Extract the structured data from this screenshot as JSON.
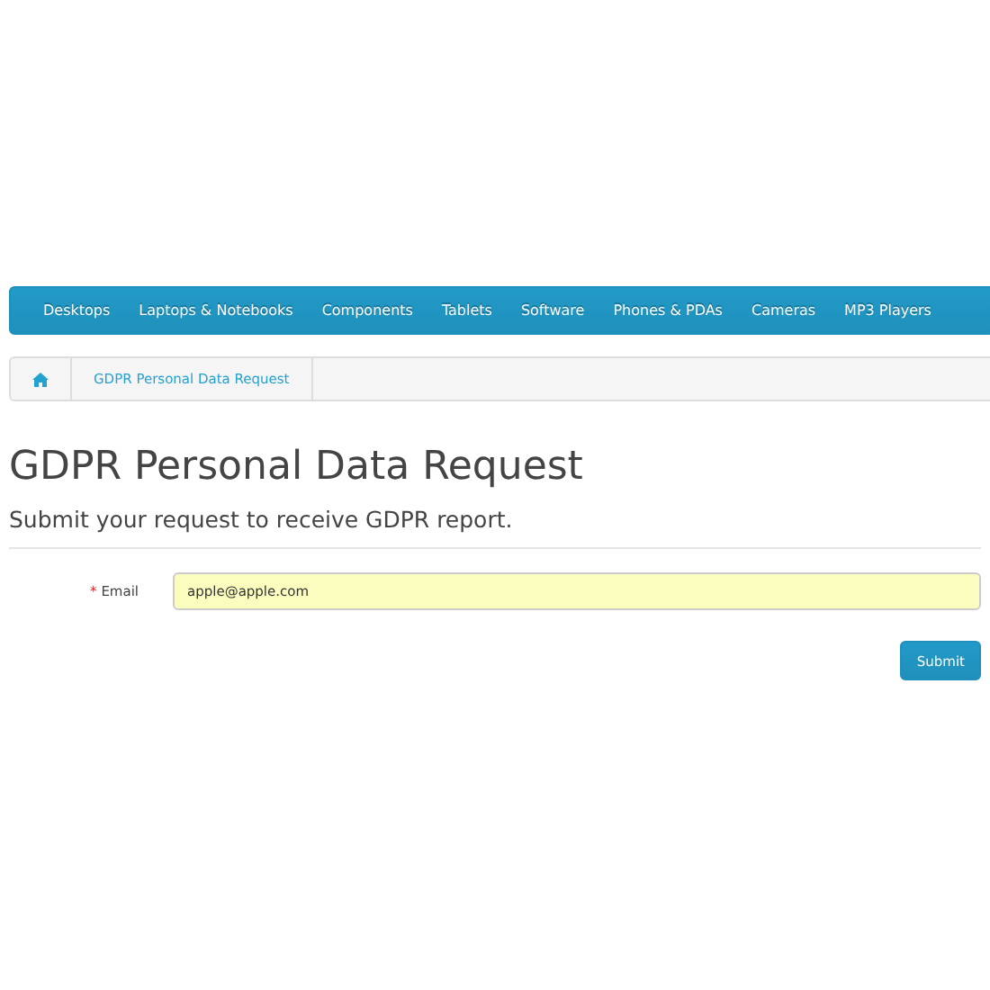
{
  "menu": [
    {
      "label": "Desktops"
    },
    {
      "label": "Laptops & Notebooks"
    },
    {
      "label": "Components"
    },
    {
      "label": "Tablets"
    },
    {
      "label": "Software"
    },
    {
      "label": "Phones & PDAs"
    },
    {
      "label": "Cameras"
    },
    {
      "label": "MP3 Players"
    }
  ],
  "breadcrumb": [
    {
      "kind": "home"
    },
    {
      "kind": "link",
      "label": "GDPR Personal Data Request"
    }
  ],
  "heading": "GDPR Personal Data Request",
  "subheading": "Submit your request to receive GDPR report.",
  "fields": [
    {
      "label": "Email",
      "required_mark": "*",
      "value": "apple@apple.com",
      "autofilled": true
    }
  ],
  "submit": "Submit"
}
